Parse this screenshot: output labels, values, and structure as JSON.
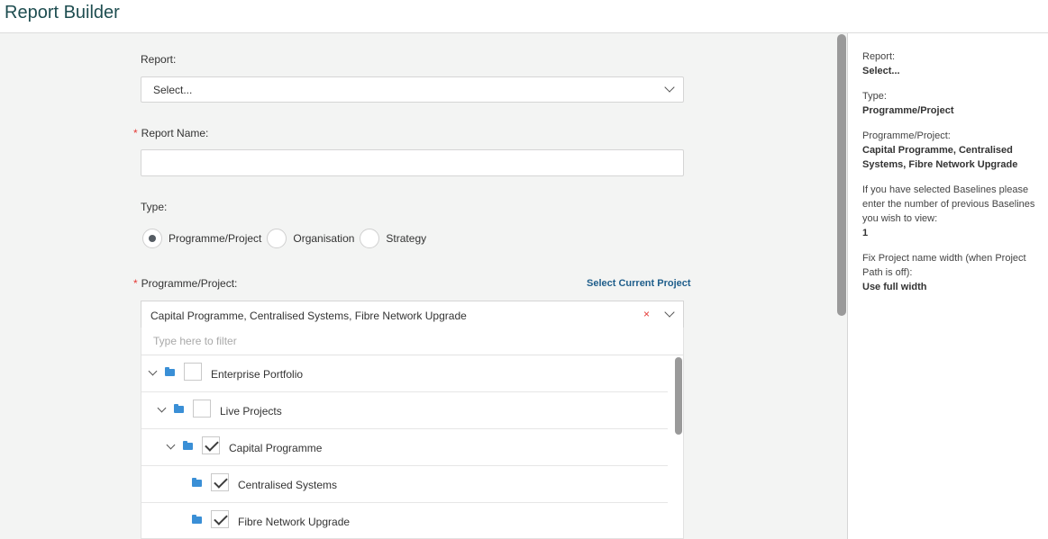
{
  "header": {
    "title": "Report Builder"
  },
  "form": {
    "report_label": "Report:",
    "report_value": "Select...",
    "report_name_label": "Report Name:",
    "report_name_value": "",
    "type_label": "Type:",
    "type_options": [
      "Programme/Project",
      "Organisation",
      "Strategy"
    ],
    "type_selected": "Programme/Project",
    "programme_label": "Programme/Project:",
    "select_current_link": "Select Current Project",
    "programme_value": "Capital Programme, Centralised Systems, Fibre Network Upgrade",
    "clear_symbol": "×",
    "filter_placeholder": "Type here to filter",
    "tree": [
      {
        "label": "Enterprise Portfolio",
        "checked": false,
        "expanded": true
      },
      {
        "label": "Live Projects",
        "checked": false,
        "expanded": true
      },
      {
        "label": "Capital Programme",
        "checked": true,
        "expanded": true
      },
      {
        "label": "Centralised Systems",
        "checked": true,
        "expanded": false
      },
      {
        "label": "Fibre Network Upgrade",
        "checked": true,
        "expanded": false
      }
    ]
  },
  "summary": {
    "report_label": "Report:",
    "report_value": "Select...",
    "type_label": "Type:",
    "type_value": "Programme/Project",
    "programme_label": "Programme/Project:",
    "programme_value": "Capital Programme, Centralised Systems, Fibre Network Upgrade",
    "baselines_label": "If you have selected Baselines please enter the number of previous Baselines you wish to view:",
    "baselines_value": "1",
    "fix_width_label": "Fix Project name width (when Project Path is off):",
    "fix_width_value": "Use full width"
  },
  "colors": {
    "accent_title": "#1e4d50",
    "link": "#1f5e8b",
    "required": "#e53935",
    "folder": "#3a8fd6"
  },
  "icons": [
    "chevron-down-icon",
    "folder-icon",
    "checkbox-icon",
    "clear-icon"
  ]
}
